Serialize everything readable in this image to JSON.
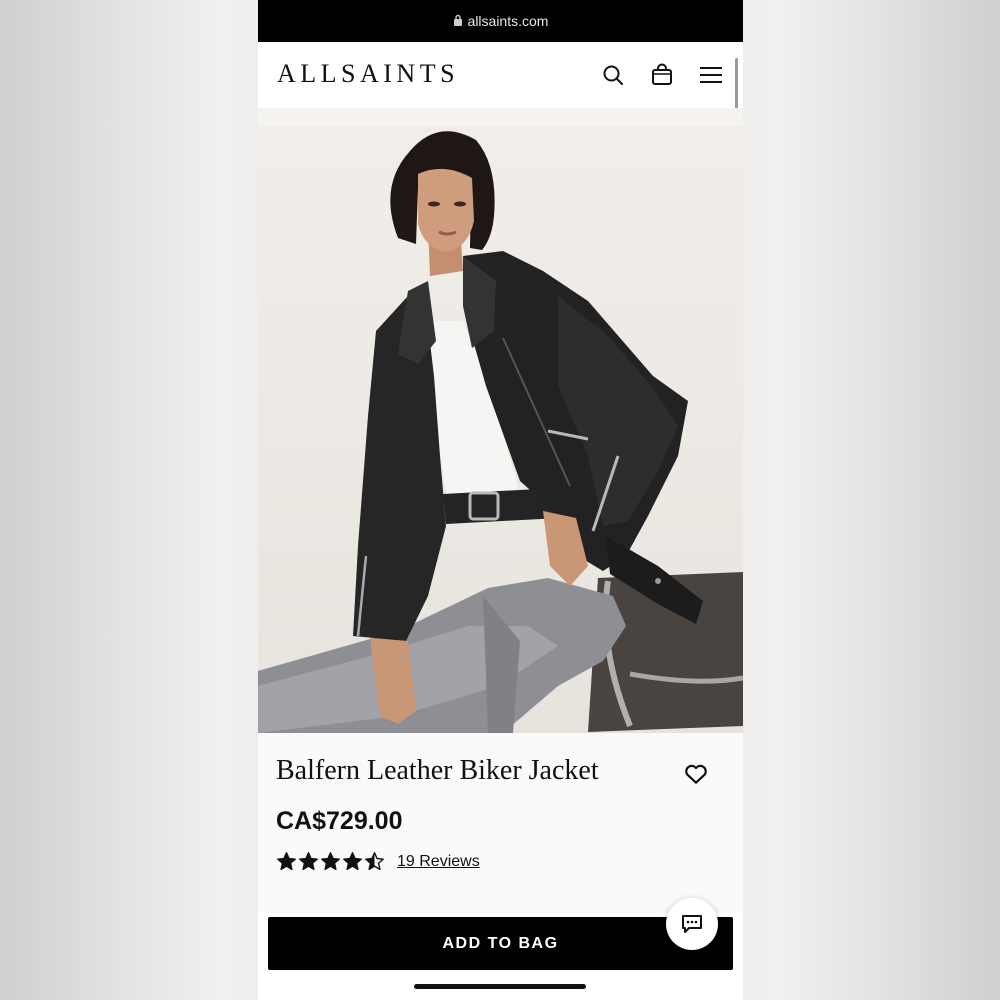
{
  "browser": {
    "url": "allsaints.com",
    "lock_icon": "lock-icon"
  },
  "header": {
    "logo": "ALLSAINTS",
    "icons": [
      "search-icon",
      "bag-icon",
      "menu-icon"
    ]
  },
  "product": {
    "title": "Balfern Leather Biker Jacket",
    "price": "CA$729.00",
    "rating": 4.5,
    "rating_max": 5,
    "reviews_label": "19 Reviews",
    "wishlist_icon": "heart-icon"
  },
  "actions": {
    "add_to_bag": "ADD TO BAG",
    "chat_icon": "chat-icon"
  },
  "colors": {
    "brand": "#000000",
    "background": "#ffffff",
    "info_background": "#fafafa"
  }
}
